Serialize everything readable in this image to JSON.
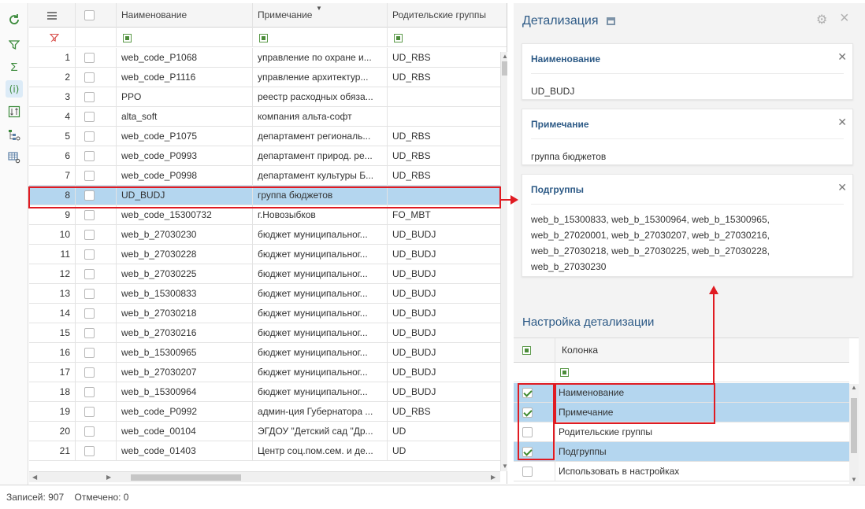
{
  "toolbar": {
    "icons": [
      "refresh-icon",
      "filter-funnel-icon",
      "sum-icon",
      "info-icon",
      "sort-columns-icon",
      "tree-settings-icon",
      "table-settings-icon"
    ]
  },
  "grid": {
    "columns": {
      "name": "Наименование",
      "note": "Примечание",
      "parent": "Родительские группы"
    },
    "rows": [
      {
        "num": "1",
        "name": "web_code_P1068",
        "note": "управление по охране и...",
        "parent": "UD_RBS"
      },
      {
        "num": "2",
        "name": "web_code_P1116",
        "note": "управление архитектур...",
        "parent": "UD_RBS"
      },
      {
        "num": "3",
        "name": "PPO",
        "note": "реестр расходных обяза...",
        "parent": ""
      },
      {
        "num": "4",
        "name": "alta_soft",
        "note": "компания альта-софт",
        "parent": ""
      },
      {
        "num": "5",
        "name": "web_code_P1075",
        "note": "департамент региональ...",
        "parent": "UD_RBS"
      },
      {
        "num": "6",
        "name": "web_code_P0993",
        "note": "департамент природ. ре...",
        "parent": "UD_RBS"
      },
      {
        "num": "7",
        "name": "web_code_P0998",
        "note": "департамент культуры Б...",
        "parent": "UD_RBS"
      },
      {
        "num": "8",
        "name": "UD_BUDJ",
        "note": "группа бюджетов",
        "parent": ""
      },
      {
        "num": "9",
        "name": "web_code_15300732",
        "note": "г.Новозыбков",
        "parent": "FO_MBT"
      },
      {
        "num": "10",
        "name": "web_b_27030230",
        "note": "бюджет муниципальног...",
        "parent": "UD_BUDJ"
      },
      {
        "num": "11",
        "name": "web_b_27030228",
        "note": "бюджет муниципальног...",
        "parent": "UD_BUDJ"
      },
      {
        "num": "12",
        "name": "web_b_27030225",
        "note": "бюджет муниципальног...",
        "parent": "UD_BUDJ"
      },
      {
        "num": "13",
        "name": "web_b_15300833",
        "note": "бюджет муниципальног...",
        "parent": "UD_BUDJ"
      },
      {
        "num": "14",
        "name": "web_b_27030218",
        "note": "бюджет муниципальног...",
        "parent": "UD_BUDJ"
      },
      {
        "num": "15",
        "name": "web_b_27030216",
        "note": "бюджет муниципальног...",
        "parent": "UD_BUDJ"
      },
      {
        "num": "16",
        "name": "web_b_15300965",
        "note": "бюджет муниципальног...",
        "parent": "UD_BUDJ"
      },
      {
        "num": "17",
        "name": "web_b_27030207",
        "note": "бюджет муниципальног...",
        "parent": "UD_BUDJ"
      },
      {
        "num": "18",
        "name": "web_b_15300964",
        "note": "бюджет муниципальног...",
        "parent": "UD_BUDJ"
      },
      {
        "num": "19",
        "name": "web_code_P0992",
        "note": "админ-ция Губернатора ...",
        "parent": "UD_RBS"
      },
      {
        "num": "20",
        "name": "web_code_00104",
        "note": "ЭГДОУ \"Детский сад \"Др...",
        "parent": "UD"
      },
      {
        "num": "21",
        "name": "web_code_01403",
        "note": "Центр соц.пом.сем. и де...",
        "parent": "UD"
      }
    ],
    "selected_row": "8"
  },
  "status": {
    "records": "Записей: 907",
    "marked": "Отмечено: 0"
  },
  "detail": {
    "title": "Детализация",
    "cards": [
      {
        "label": "Наименование",
        "value": "UD_BUDJ"
      },
      {
        "label": "Примечание",
        "value": "группа бюджетов"
      },
      {
        "label": "Подгруппы",
        "value": "web_b_15300833, web_b_15300964, web_b_15300965, web_b_27020001, web_b_27030207, web_b_27030216, web_b_27030218, web_b_27030225, web_b_27030228, web_b_27030230"
      }
    ],
    "settings_title": "Настройка детализации",
    "settings_column_header": "Колонка",
    "settings_rows": [
      {
        "label": "Наименование",
        "checked": true
      },
      {
        "label": "Примечание",
        "checked": true
      },
      {
        "label": "Родительские группы",
        "checked": false
      },
      {
        "label": "Подгруппы",
        "checked": true
      },
      {
        "label": "Использовать в настройках",
        "checked": false
      }
    ]
  },
  "colors": {
    "accent": "#2d5a86",
    "selection": "#b4d6ef",
    "highlight": "#e01b22",
    "toolbar_icon": "#3a8a3a"
  }
}
